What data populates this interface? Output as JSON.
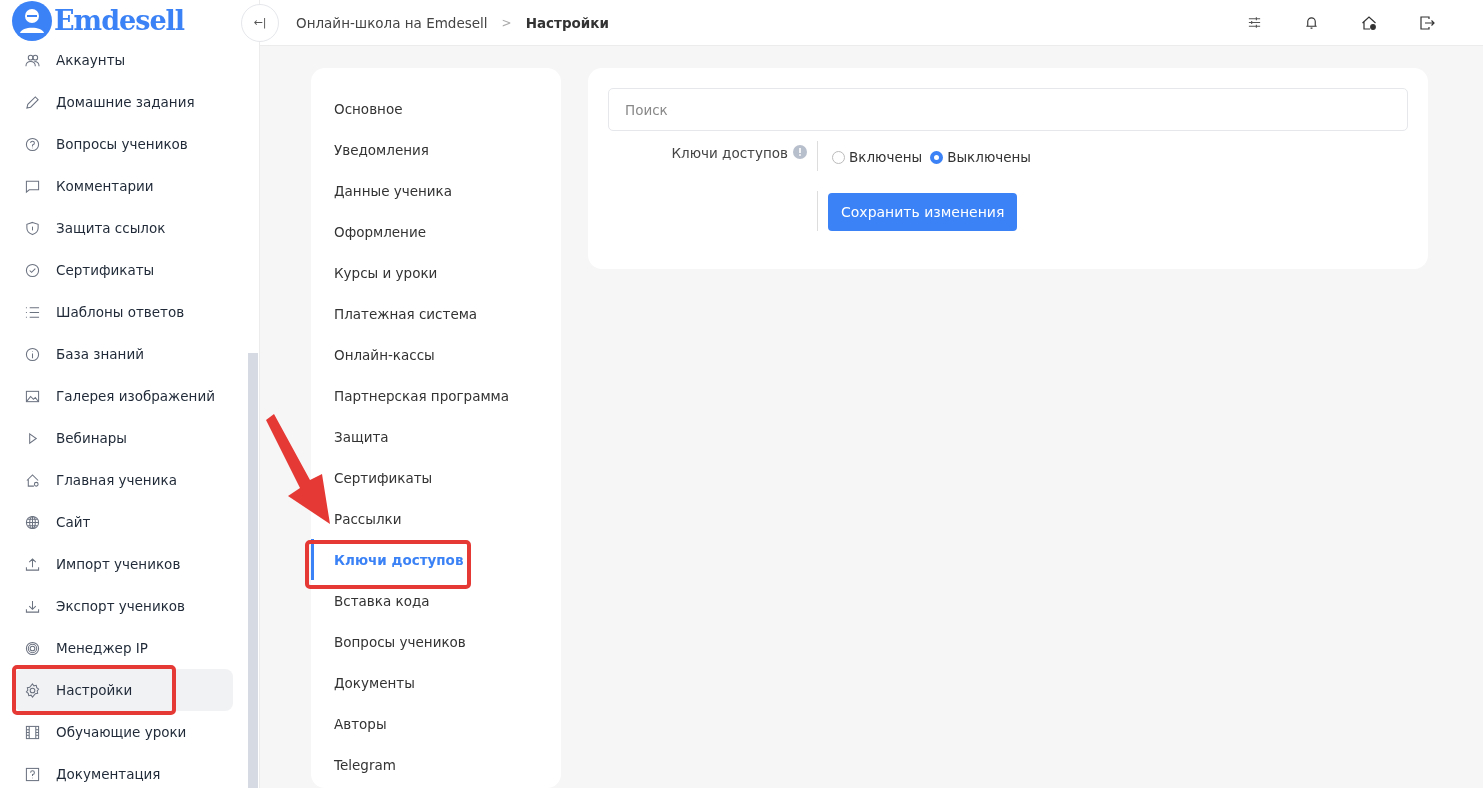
{
  "logo": {
    "text": "Emdesell"
  },
  "sidebar": {
    "items": [
      {
        "label": "Аккаунты",
        "selected": false,
        "annotated": false
      },
      {
        "label": "Домашние задания",
        "selected": false,
        "annotated": false
      },
      {
        "label": "Вопросы учеников",
        "selected": false,
        "annotated": false
      },
      {
        "label": "Комментарии",
        "selected": false,
        "annotated": false
      },
      {
        "label": "Защита ссылок",
        "selected": false,
        "annotated": false
      },
      {
        "label": "Сертификаты",
        "selected": false,
        "annotated": false
      },
      {
        "label": "Шаблоны ответов",
        "selected": false,
        "annotated": false
      },
      {
        "label": "База знаний",
        "selected": false,
        "annotated": false
      },
      {
        "label": "Галерея изображений",
        "selected": false,
        "annotated": false
      },
      {
        "label": "Вебинары",
        "selected": false,
        "annotated": false
      },
      {
        "label": "Главная ученика",
        "selected": false,
        "annotated": false
      },
      {
        "label": "Сайт",
        "selected": false,
        "annotated": false
      },
      {
        "label": "Импорт учеников",
        "selected": false,
        "annotated": false
      },
      {
        "label": "Экспорт учеников",
        "selected": false,
        "annotated": false
      },
      {
        "label": "Менеджер IP",
        "selected": false,
        "annotated": false
      },
      {
        "label": "Настройки",
        "selected": true,
        "annotated": true
      },
      {
        "label": "Обучающие уроки",
        "selected": false,
        "annotated": false
      },
      {
        "label": "Документация",
        "selected": false,
        "annotated": false
      }
    ]
  },
  "header": {
    "collapse_icon": "←|",
    "breadcrumbs": [
      {
        "label": "Онлайн-школа на Emdesell",
        "current": false
      },
      {
        "label": "Настройки",
        "current": true
      }
    ],
    "separator": ">"
  },
  "settings_menu": {
    "items": [
      {
        "label": "Основное",
        "selected": false,
        "annotated": false
      },
      {
        "label": "Уведомления",
        "selected": false,
        "annotated": false
      },
      {
        "label": "Данные ученика",
        "selected": false,
        "annotated": false
      },
      {
        "label": "Оформление",
        "selected": false,
        "annotated": false
      },
      {
        "label": "Курсы и уроки",
        "selected": false,
        "annotated": false
      },
      {
        "label": "Платежная система",
        "selected": false,
        "annotated": false
      },
      {
        "label": "Онлайн-кассы",
        "selected": false,
        "annotated": false
      },
      {
        "label": "Партнерская программа",
        "selected": false,
        "annotated": false
      },
      {
        "label": "Защита",
        "selected": false,
        "annotated": false
      },
      {
        "label": "Сертификаты",
        "selected": false,
        "annotated": false
      },
      {
        "label": "Рассылки",
        "selected": false,
        "annotated": false
      },
      {
        "label": "Ключи доступов",
        "selected": true,
        "annotated": true
      },
      {
        "label": "Вставка кода",
        "selected": false,
        "annotated": false
      },
      {
        "label": "Вопросы учеников",
        "selected": false,
        "annotated": false
      },
      {
        "label": "Документы",
        "selected": false,
        "annotated": false
      },
      {
        "label": "Авторы",
        "selected": false,
        "annotated": false
      },
      {
        "label": "Telegram",
        "selected": false,
        "annotated": false
      }
    ]
  },
  "panel": {
    "search": {
      "placeholder": "Поиск"
    },
    "setting": {
      "label": "Ключи доступов",
      "options": [
        {
          "label": "Включены",
          "selected": false
        },
        {
          "label": "Выключены",
          "selected": true
        }
      ]
    },
    "save_button": "Сохранить изменения"
  }
}
